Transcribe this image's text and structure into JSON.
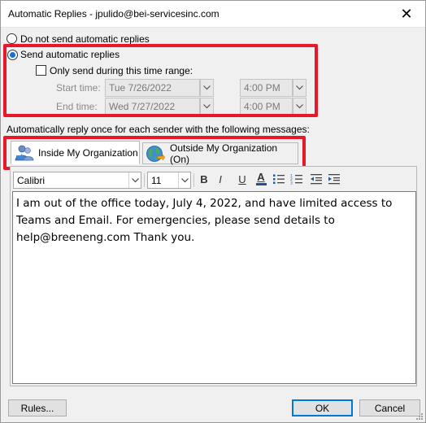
{
  "window": {
    "title": "Automatic Replies - jpulido@bei-servicesinc.com",
    "close_glyph": "✕"
  },
  "options": {
    "do_not_send": "Do not send automatic replies",
    "send": "Send automatic replies",
    "selected": "send"
  },
  "time_range": {
    "checkbox_label": "Only send during this time range:",
    "checked": false,
    "start_label": "Start time:",
    "start_date": "Tue 7/26/2022",
    "start_time": "4:00 PM",
    "end_label": "End time:",
    "end_date": "Wed 7/27/2022",
    "end_time": "4:00 PM"
  },
  "reply_label": "Automatically reply once for each sender with the following messages:",
  "tabs": [
    {
      "label": "Inside My Organization",
      "icon": "people-icon",
      "active": true
    },
    {
      "label": "Outside My Organization (On)",
      "icon": "globe-icon",
      "active": false
    }
  ],
  "formatting": {
    "font": "Calibri",
    "size": "11",
    "bold": "B",
    "italic": "I",
    "underline": "U",
    "font_color": "A"
  },
  "message": "I am out of the office today, July 4, 2022, and have limited access to Teams and Email. For emergencies, please send details to help@breeneng.com Thank you.",
  "buttons": {
    "rules": "Rules...",
    "ok": "OK",
    "cancel": "Cancel"
  },
  "colors": {
    "highlight_box": "#e8182b",
    "radio_selected": "#1a6fd4",
    "default_button_border": "#0078d7"
  }
}
